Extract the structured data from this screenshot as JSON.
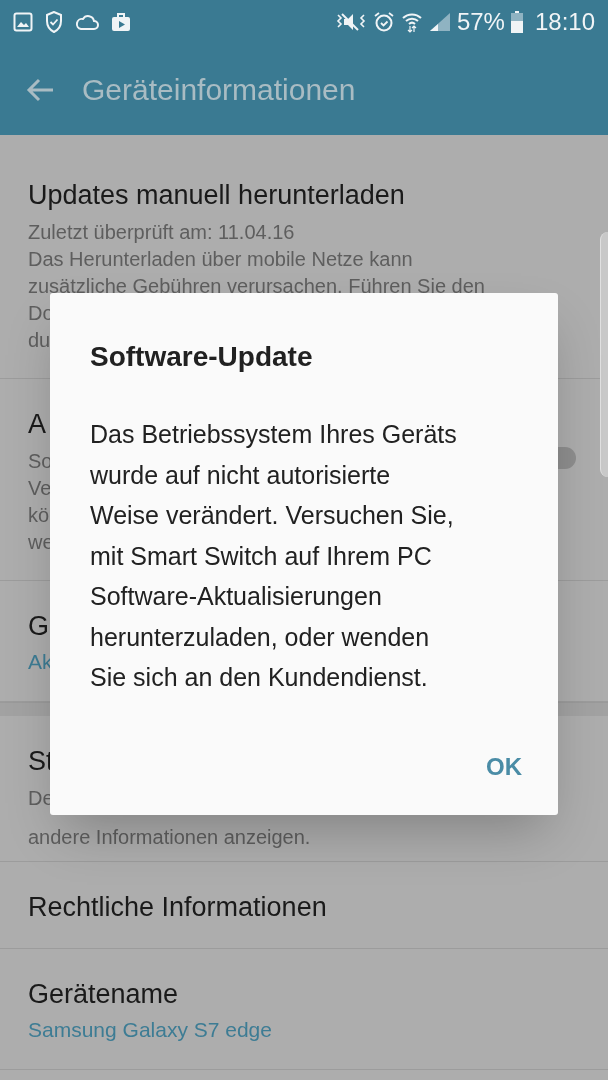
{
  "status_bar": {
    "battery": "57%",
    "time": "18:10"
  },
  "app_bar": {
    "title": "Geräteinformationen"
  },
  "groups": [
    [
      {
        "title": "Updates manuell herunterladen",
        "summary": [
          "Zuletzt überprüft am: 11.04.16",
          "Das Herunterladen über mobile Netze kann",
          "zusätzliche Gebühren verursachen. Führen Sie den",
          "Do",
          "du"
        ]
      },
      {
        "title": "A",
        "summary": [
          "So",
          "Ve",
          "kö",
          "we"
        ],
        "toggle": {
          "on": false
        }
      },
      {
        "title": "G",
        "value": "Ak"
      }
    ],
    [
      {
        "title": "St",
        "summary": [
          "De",
          "andere Informationen anzeigen."
        ]
      },
      {
        "title": "Rechtliche Informationen"
      },
      {
        "title": "Gerätename",
        "value": "Samsung Galaxy S7 edge"
      }
    ]
  ],
  "dialog": {
    "title": "Software-Update",
    "message": "Das Betriebssystem Ihres Geräts wurde auf nicht autorisierte Weise verändert. Versuchen Sie, mit Smart Switch auf Ihrem PC Software-Aktualisierungen herunterzuladen, oder wenden Sie sich an den Kundendienst.",
    "buttons": [
      "OK"
    ]
  }
}
